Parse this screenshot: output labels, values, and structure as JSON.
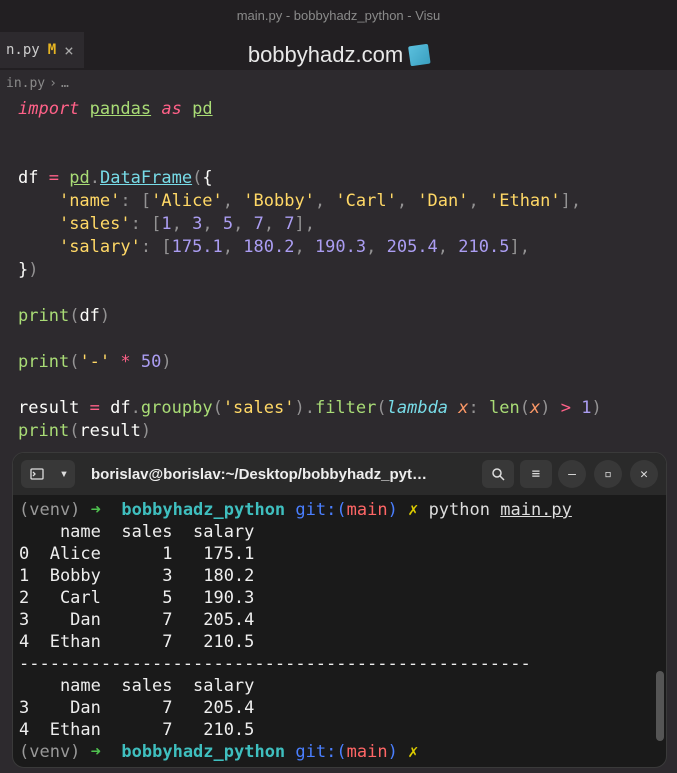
{
  "window": {
    "title": "main.py - bobbyhadz_python - Visu"
  },
  "tab": {
    "filename": "n.py",
    "modified_marker": "M",
    "close": "×"
  },
  "watermark": {
    "text": "bobbyhadz.com"
  },
  "breadcrumb": {
    "file": "in.py",
    "sep": "›",
    "dots": "…"
  },
  "code": {
    "l1_import": "import",
    "l1_pandas": "pandas",
    "l1_as": "as",
    "l1_pd": "pd",
    "l4_df": "df",
    "l4_eq": "=",
    "l4_pd": "pd",
    "l4_dot": ".",
    "l4_DF": "DataFrame",
    "l4_open": "({",
    "l5_name": "'name'",
    "l5_colon": ":",
    "l5_vals": "['Alice', 'Bobby', 'Carl', 'Dan', 'Ethan']",
    "l5_comma": ",",
    "l6_sales": "'sales'",
    "l6_vals": "[1, 3, 5, 7, 7]",
    "l7_salary": "'salary'",
    "l7_vals": "[175.1, 180.2, 190.3, 205.4, 210.5]",
    "l8_close": "})",
    "l10_print": "print",
    "l10_df": "df",
    "l12_print": "print",
    "l12_dash": "'-'",
    "l12_star": "*",
    "l12_50": "50",
    "l14_result": "result",
    "l14_eq": "=",
    "l14_df": "df",
    "l14_groupby": "groupby",
    "l14_sales": "'sales'",
    "l14_filter": "filter",
    "l14_lambda": "lambda",
    "l14_x": "x",
    "l14_len": "len",
    "l14_gt": ">",
    "l14_1": "1",
    "l15_print": "print",
    "l15_result": "result"
  },
  "terminal": {
    "title": "borislav@borislav:~/Desktop/bobbyhadz_pyt…",
    "prompt": {
      "venv": "(venv)",
      "arrow": "➜",
      "dir": "bobbyhadz_python",
      "git": "git:(",
      "branch": "main",
      "close": ")",
      "x": "✗"
    },
    "cmd1": "python",
    "cmd1_file": "main.py",
    "output_header": "    name  sales  salary",
    "rows1": [
      "0  Alice      1   175.1",
      "1  Bobby      3   180.2",
      "2   Carl      5   190.3",
      "3    Dan      7   205.4",
      "4  Ethan      7   210.5"
    ],
    "divider": "--------------------------------------------------",
    "output_header2": "    name  sales  salary",
    "rows2": [
      "3    Dan      7   205.4",
      "4  Ethan      7   210.5"
    ]
  }
}
